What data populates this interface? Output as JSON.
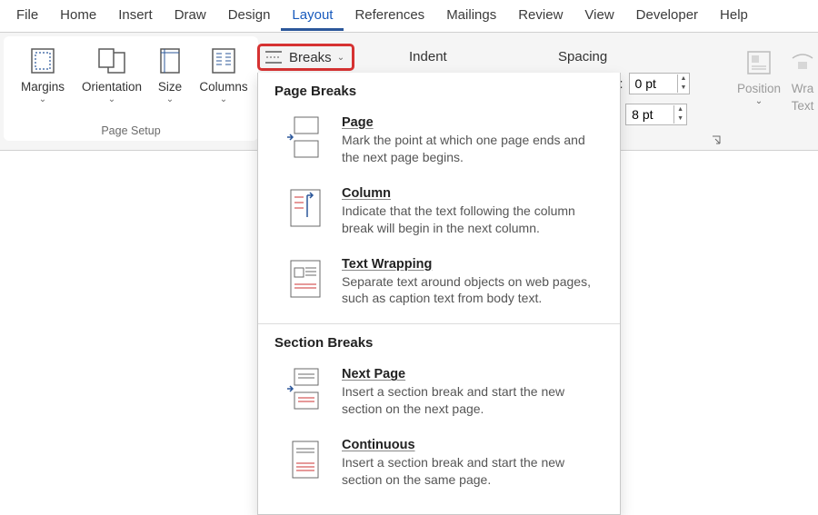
{
  "tabs": [
    "File",
    "Home",
    "Insert",
    "Draw",
    "Design",
    "Layout",
    "References",
    "Mailings",
    "Review",
    "View",
    "Developer",
    "Help"
  ],
  "active_tab": "Layout",
  "page_setup": {
    "label": "Page Setup",
    "margins": "Margins",
    "orientation": "Orientation",
    "size": "Size",
    "columns": "Columns"
  },
  "breaks_btn": "Breaks",
  "indent_label": "Indent",
  "spacing_label": "Spacing",
  "paragraph": {
    "before_suffix": "re:",
    "after_suffix": ":",
    "before_value": "0 pt",
    "after_value": "8 pt"
  },
  "arrange": {
    "position": "Position",
    "wrap": "Wra",
    "wrap2": "Text"
  },
  "gallery": {
    "page_breaks_header": "Page Breaks",
    "section_breaks_header": "Section Breaks",
    "page": {
      "title": "Page",
      "desc": "Mark the point at which one page ends and the next page begins."
    },
    "column": {
      "title": "Column",
      "desc": "Indicate that the text following the column break will begin in the next column."
    },
    "wrap": {
      "title": "Text Wrapping",
      "desc": "Separate text around objects on web pages, such as caption text from body text."
    },
    "nextpage": {
      "title": "Next Page",
      "desc": "Insert a section break and start the new section on the next page."
    },
    "continuous": {
      "title": "Continuous",
      "desc": "Insert a section break and start the new section on the same page."
    }
  }
}
